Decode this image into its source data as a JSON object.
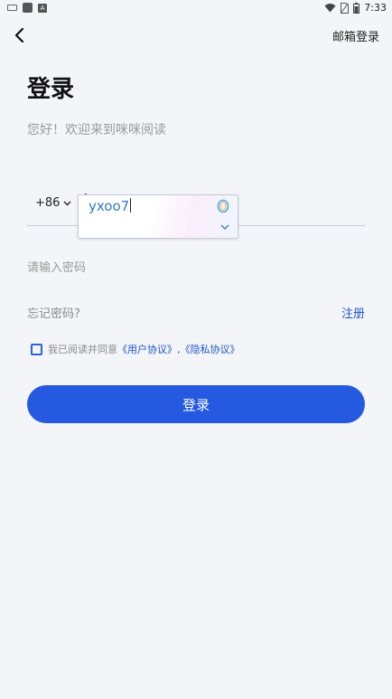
{
  "status_bar": {
    "time": "7:33"
  },
  "header": {
    "email_login": "邮箱登录"
  },
  "main": {
    "title": "登录",
    "subtitle": "您好！欢迎来到咪咪阅读",
    "country_code": "+86",
    "autofill_value": "yxoo7",
    "password_placeholder": "请输入密码",
    "forgot_password": "忘记密码?",
    "register": "注册",
    "agree_prefix": "我已阅读并同意",
    "user_agreement": "《用户协议》",
    "separator": ",",
    "privacy_policy": "《隐私协议》",
    "login_button": "登录"
  },
  "colors": {
    "accent": "#2459e0",
    "link": "#2255c9",
    "background": "#f3f5f9"
  },
  "icons": [
    "back-arrow-icon",
    "chevron-down-icon",
    "wifi-icon",
    "no-sim-icon",
    "battery-icon",
    "assistant-icon"
  ]
}
